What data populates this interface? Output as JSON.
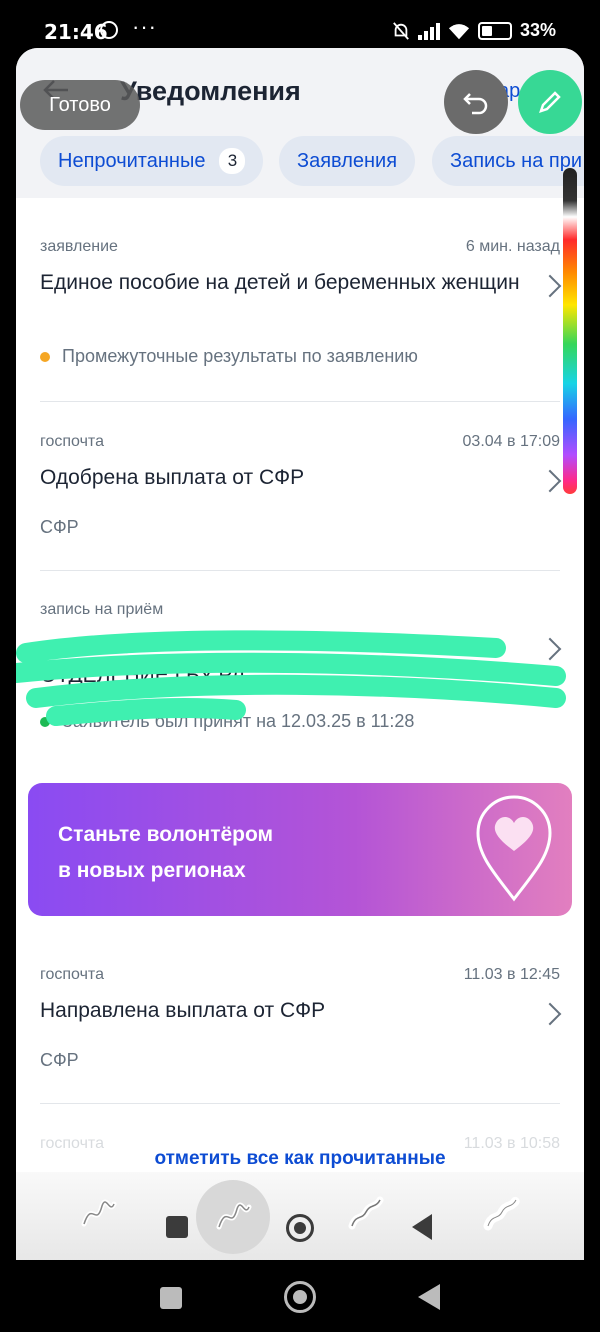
{
  "status_bar": {
    "time": "21:46",
    "battery": "33%"
  },
  "header": {
    "title": "Уведомления",
    "done": "Готово",
    "link_partial": "ар"
  },
  "chips": [
    {
      "label": "Непрочитанные",
      "count": "3"
    },
    {
      "label": "Заявления"
    },
    {
      "label": "Запись на при"
    }
  ],
  "notifications": [
    {
      "category": "заявление",
      "time": "6 мин. назад",
      "title": "Единое пособие на детей и беременных женщин",
      "subtitle": "Промежуточные результаты по заявлению",
      "dot_color": "#f5a623"
    },
    {
      "category": "госпочта",
      "time": "03.04 в 17:09",
      "title": "Одобрена выплата от СФР",
      "subtitle": "СФР"
    },
    {
      "category": "запись на приём",
      "time": "",
      "title": "ОТДЕЛЕНИЕ ГБУ РД \"...\"",
      "subtitle": "Заявитель был принят на 12.03.25 в 11:28",
      "dot_color": "#1db954"
    },
    {
      "category": "госпочта",
      "time": "11.03 в 12:45",
      "title": "Направлена выплата от СФР",
      "subtitle": "СФР"
    },
    {
      "category": "госпочта",
      "time": "11.03 в 10:58"
    }
  ],
  "banner": {
    "line1": "Станьте волонтёром",
    "line2": "в новых регионах"
  },
  "footer": {
    "mark_all_read": "отметить все как прочитанные"
  },
  "colors": {
    "accent": "#0d4cd3",
    "pen": "#37d895",
    "scribble": "#3ff0b0"
  }
}
